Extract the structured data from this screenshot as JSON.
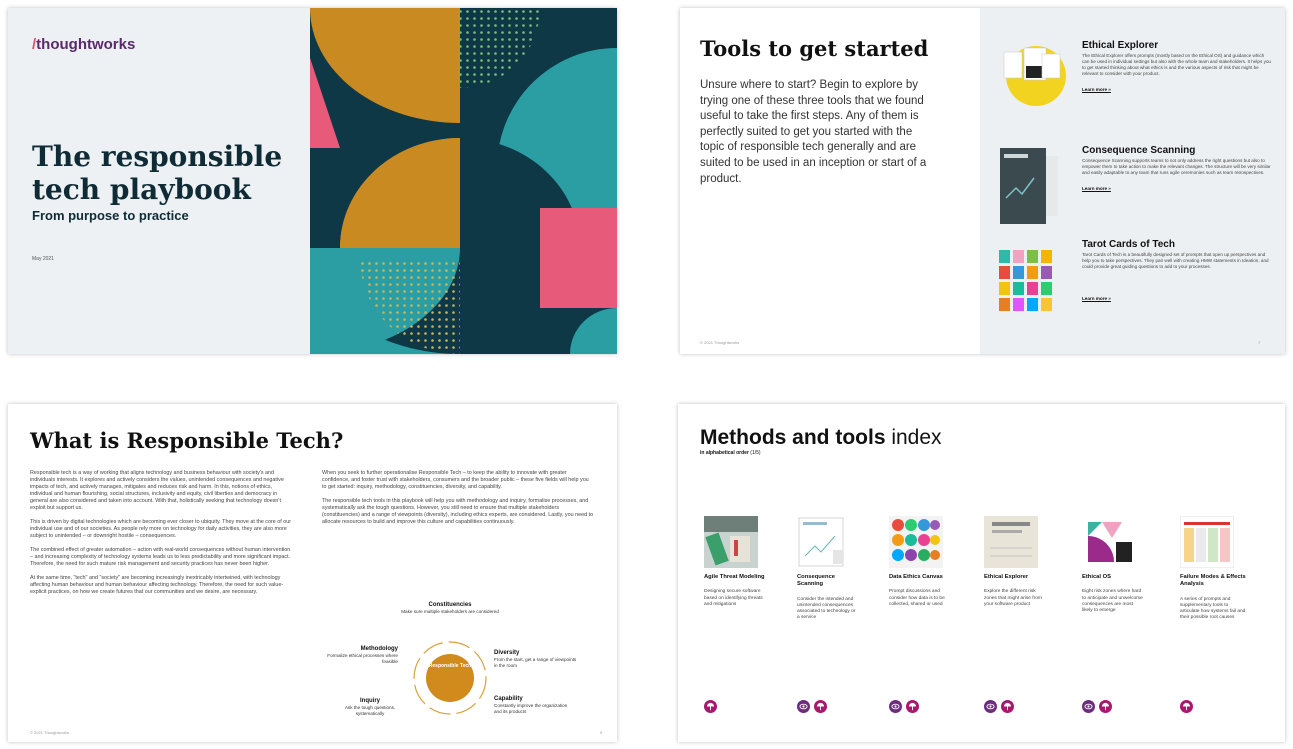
{
  "colors": {
    "teal": "#2a9ea3",
    "navy": "#0f3847",
    "mustard": "#c98a22",
    "pink": "#e85a79",
    "bg_grey": "#edf1f3",
    "brand_purple": "#6c2d7f",
    "brand_magenta": "#a8186d"
  },
  "slide1": {
    "logo": "thoughtworks",
    "logo_slash": "/",
    "title": "The responsible tech playbook",
    "subtitle": "From purpose to practice",
    "date": "May 2021"
  },
  "slide2": {
    "heading": "Tools to get started",
    "intro": "Unsure where to start? Begin to explore by trying one of these three tools that we found useful to take the first steps. Any of them is perfectly suited to get you started with the topic of responsible tech generally and are suited to be used in an inception or start of a product.",
    "footer": "© 2021 Thoughtworks",
    "page_number": "7",
    "tools": [
      {
        "name": "Ethical Explorer",
        "desc": "The Ethical Explorer offers prompts (mostly based on the Ethical OS) and guidance which can be used in individual settings but also with the whole team and stakeholders. It helps you to get started thinking about what ethics is and the various aspects of risk that might be relevant to consider with your product.",
        "link": "Learn more »",
        "icon": "ethical-explorer-thumbnail"
      },
      {
        "name": "Consequence Scanning",
        "desc": "Consequence Scanning supports teams to not only address the right questions but also to empower them to take action to make the relevant changes. The structure will be very similar and easily adaptable to any team that runs agile ceremonies such as team retrospectives.",
        "link": "Learn more »",
        "icon": "consequence-scanning-thumbnail"
      },
      {
        "name": "Tarot Cards of Tech",
        "desc": "Tarot Cards of Tech is a beautifully designed set of prompts that open up perspectives and help you to take perspectives. They pair well with creating HMW statements in Ideation, and could provide great guiding questions to add to your processes.",
        "link": "Learn more »",
        "icon": "tarot-cards-thumbnail"
      }
    ]
  },
  "slide3": {
    "heading": "What is Responsible Tech?",
    "left_paragraphs": [
      "Responsible tech is a way of working that aligns technology and business behaviour with society's and individuals interests. It explores and actively considers the values, unintended consequences and negative impacts of tech, and actively manages, mitigates and reduces risk and harm. In this, notions of ethics, individual and human flourishing, social structures, inclusivity and equity, civil liberties and democracy in general are also considered and taken into account. With that, holistically seeking that technology doesn't exploit but support us.",
      "This is driven by digital technologies which are becoming ever closer to ubiquity. They move at the core of our individual use and of our societies. As people rely more on technology for daily activities, they are also more subject to unintended – or downright hostile – consequences.",
      "The combined effect of greater automation – action with real-world consequences without human intervention – and increasing complexity of technology systems leads us to less predictability and more significant impact. Therefore, the need for such mature risk management and security practices has never been higher.",
      "At the same time, \"tech\" and \"society\" are becoming increasingly inextricably intertwined, with technology affecting human behaviour and human behaviour affecting technology. Therefore, the need for such value-explicit practices, on how we create futures that our communities and we desire, are necessary."
    ],
    "right_paragraphs": [
      "When you seek to further operationalise Responsible Tech – to keep the ability to innovate with greater confidence, and foster trust with stakeholders, consumers and the broader public – these five fields will help you to get started: inquiry, methodology, constituencies, diversity, and capability.",
      "The responsible tech tools in this playbook will help you with methodology and inquiry, formalise processes, and systematically ask the tough questions. However, you still need to ensure that multiple stakeholders (constituencies) and a range of viewpoints (diversity), including ethics experts, are considered. Lastly, you need to allocate resources to build and improve this culture and capabilities continuously."
    ],
    "diagram": {
      "center": "Responsible Tech",
      "constituencies": {
        "title": "Constituencies",
        "desc": "Make sure multiple stakeholders are considered"
      },
      "diversity": {
        "title": "Diversity",
        "desc": "From the start, get a range of viewpoints in the room"
      },
      "capability": {
        "title": "Capability",
        "desc": "Constantly improve the organization and its products"
      },
      "inquiry": {
        "title": "Inquiry",
        "desc": "Ask the tough questions, systematically"
      },
      "methodology": {
        "title": "Methodology",
        "desc": "Formalize ethical processes where feasible"
      }
    },
    "footer": "© 2021 Thoughtworks",
    "page_number": "5"
  },
  "slide4": {
    "heading_bold": "Methods and tools",
    "heading_light": " index",
    "subheading": "in alphabetical order",
    "subheading_count": "(1/5)",
    "methods": [
      {
        "title": "Agile Threat Modeling",
        "desc": "Designing secure software based on identifying threats and mitigations",
        "icons": [
          "a"
        ]
      },
      {
        "title": "Consequence Scanning",
        "desc": "Consider the intended and unintended consequences associated to technology or a service",
        "icons": [
          "b",
          "a"
        ]
      },
      {
        "title": "Data Ethics Canvas",
        "desc": "Prompt discussions and consider how data is to be collected, shared or used",
        "icons": [
          "b",
          "a"
        ]
      },
      {
        "title": "Ethical Explorer",
        "desc": "Explore the different risk zones that might arise from your software product",
        "icons": [
          "b",
          "a"
        ]
      },
      {
        "title": "Ethical OS",
        "desc": "Eight risk zones where hard to anticipate and unwelcome consequences are most likely to emerge",
        "icons": [
          "b",
          "a"
        ]
      },
      {
        "title": "Failure Modes & Effects Analysis",
        "desc": "A series of prompts and supplementary tools to articulate how systems fail and their possible root causes",
        "icons": [
          "a"
        ]
      }
    ]
  }
}
